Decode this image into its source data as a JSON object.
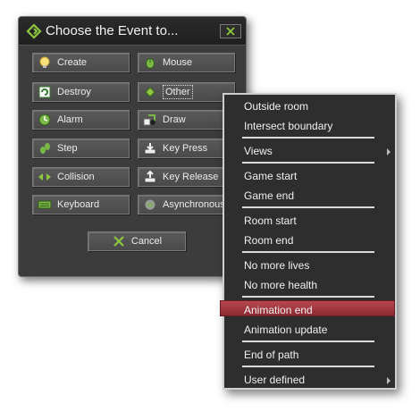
{
  "dialog": {
    "title": "Choose the Event to...",
    "buttons": {
      "create": "Create",
      "mouse": "Mouse",
      "destroy": "Destroy",
      "other": "Other",
      "alarm": "Alarm",
      "draw": "Draw",
      "step": "Step",
      "key_press": "Key Press",
      "collision": "Collision",
      "key_release": "Key Release",
      "keyboard": "Keyboard",
      "asynchronous": "Asynchronous"
    },
    "cancel": "Cancel"
  },
  "menu": {
    "items": {
      "outside_room": "Outside room",
      "intersect_boundary": "Intersect boundary",
      "views": "Views",
      "game_start": "Game start",
      "game_end": "Game end",
      "room_start": "Room start",
      "room_end": "Room end",
      "no_more_lives": "No more lives",
      "no_more_health": "No more health",
      "animation_end": "Animation end",
      "animation_update": "Animation update",
      "end_of_path": "End of path",
      "user_defined": "User defined"
    },
    "highlighted": "Animation end",
    "highlight_color": "#a53a42"
  },
  "colors": {
    "dialog_bg": "#3c3c3c",
    "accent_green": "#8dc63f"
  }
}
